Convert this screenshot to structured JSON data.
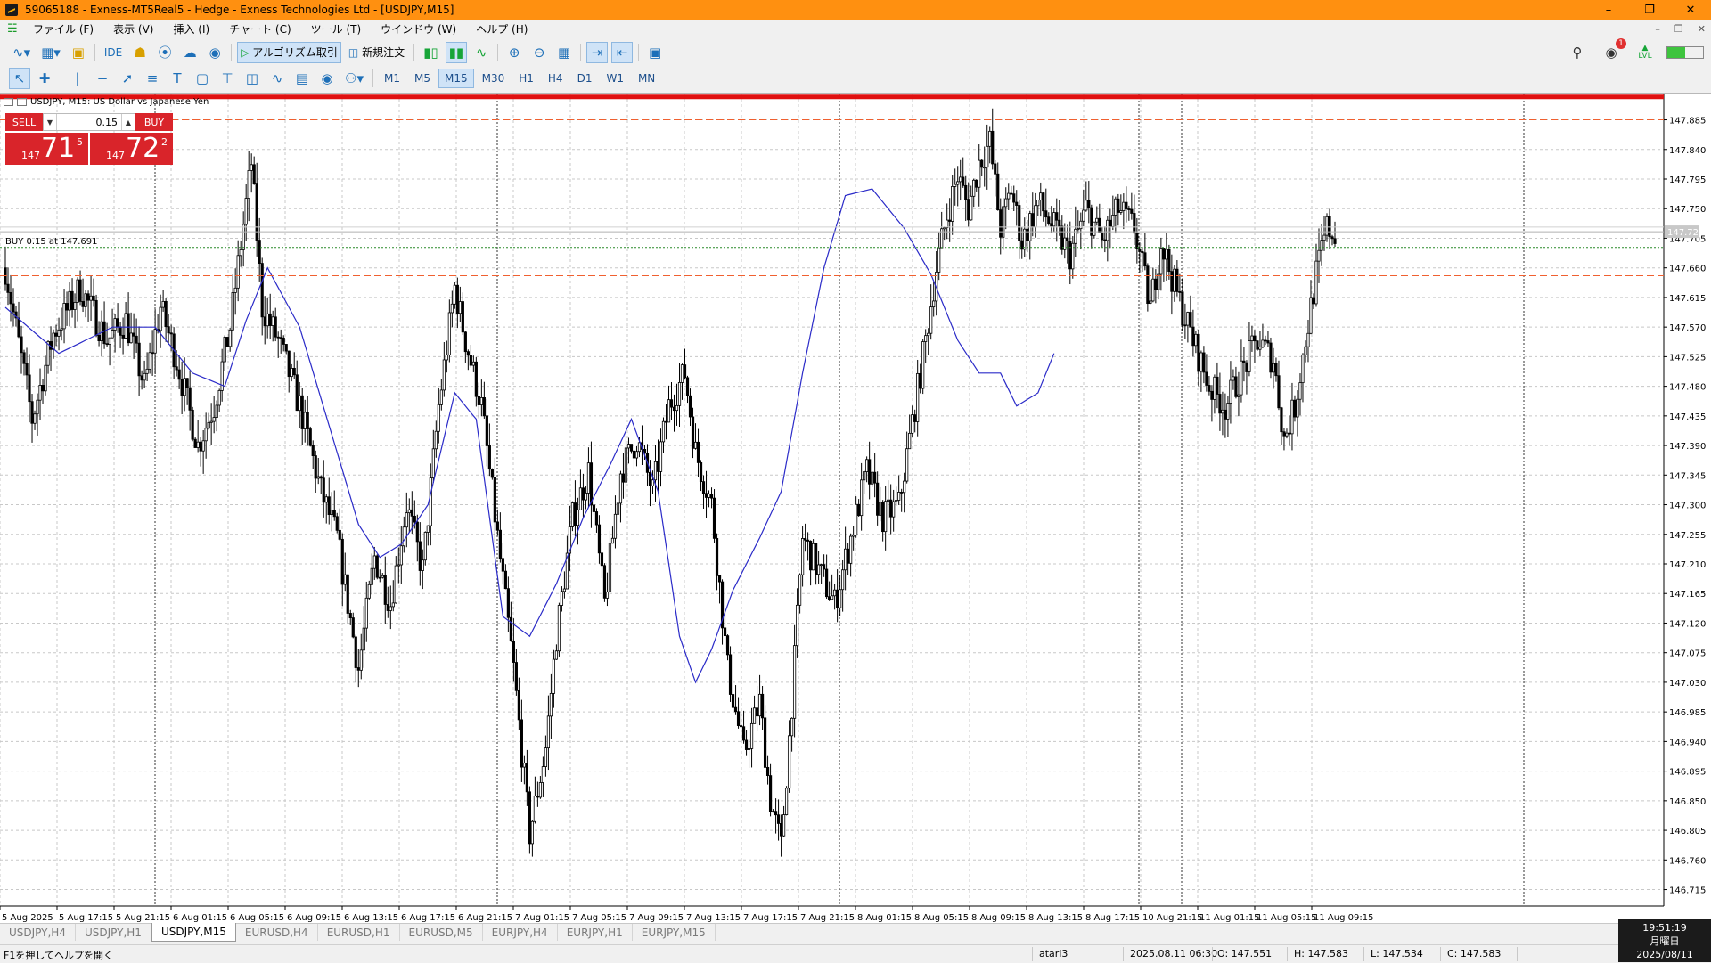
{
  "window": {
    "title": "59065188 - Exness-MT5Real5 - Hedge - Exness Technologies Ltd - [USDJPY,M15]"
  },
  "menu": [
    "ファイル (F)",
    "表示 (V)",
    "挿入 (I)",
    "チャート (C)",
    "ツール (T)",
    "ウインドウ (W)",
    "ヘルプ (H)"
  ],
  "toolbar1": {
    "ide_label": "IDE",
    "algo_label": "アルゴリズム取引",
    "new_order_label": "新規注文",
    "notifications_count": "1",
    "signal_label": "LVL"
  },
  "timeframes": [
    {
      "label": "M1",
      "active": false
    },
    {
      "label": "M5",
      "active": false
    },
    {
      "label": "M15",
      "active": true
    },
    {
      "label": "M30",
      "active": false
    },
    {
      "label": "H1",
      "active": false
    },
    {
      "label": "H4",
      "active": false
    },
    {
      "label": "D1",
      "active": false
    },
    {
      "label": "W1",
      "active": false
    },
    {
      "label": "MN",
      "active": false
    }
  ],
  "chart_header": "USDJPY, M15:  US Dollar vs Japanese Yen",
  "one_click": {
    "sell_label": "SELL",
    "buy_label": "BUY",
    "volume": "0.15",
    "sell_prefix": "147",
    "sell_big": "71",
    "sell_sup": "5",
    "buy_prefix": "147",
    "buy_big": "72",
    "buy_sup": "2"
  },
  "position_label": "BUY 0.15 at 147.691",
  "current_price_label": "147.720",
  "chart_data": {
    "type": "candlestick",
    "symbol": "USDJPY",
    "timeframe": "M15",
    "ylim": [
      146.69,
      147.925
    ],
    "y_ticks": [
      "147.885",
      "147.840",
      "147.795",
      "147.750",
      "147.705",
      "147.660",
      "147.615",
      "147.570",
      "147.525",
      "147.480",
      "147.435",
      "147.390",
      "147.345",
      "147.300",
      "147.255",
      "147.210",
      "147.165",
      "147.120",
      "147.075",
      "147.030",
      "146.985",
      "146.940",
      "146.895",
      "146.850",
      "146.805",
      "146.760",
      "146.715"
    ],
    "x_ticks": [
      "5 Aug 2025",
      "5 Aug 17:15",
      "5 Aug 21:15",
      "6 Aug 01:15",
      "6 Aug 05:15",
      "6 Aug 09:15",
      "6 Aug 13:15",
      "6 Aug 17:15",
      "6 Aug 21:15",
      "7 Aug 01:15",
      "7 Aug 05:15",
      "7 Aug 09:15",
      "7 Aug 13:15",
      "7 Aug 17:15",
      "7 Aug 21:15",
      "8 Aug 01:15",
      "8 Aug 05:15",
      "8 Aug 09:15",
      "8 Aug 13:15",
      "8 Aug 17:15",
      "10 Aug 21:15",
      "11 Aug 01:15",
      "11 Aug 05:15",
      "11 Aug 09:15"
    ],
    "price_path": [
      [
        0,
        147.66
      ],
      [
        10,
        147.43
      ],
      [
        18,
        147.56
      ],
      [
        28,
        147.63
      ],
      [
        38,
        147.55
      ],
      [
        45,
        147.58
      ],
      [
        52,
        147.48
      ],
      [
        58,
        147.6
      ],
      [
        64,
        147.52
      ],
      [
        72,
        147.39
      ],
      [
        78,
        147.45
      ],
      [
        84,
        147.57
      ],
      [
        92,
        147.82
      ],
      [
        96,
        147.6
      ],
      [
        102,
        147.55
      ],
      [
        110,
        147.45
      ],
      [
        118,
        147.32
      ],
      [
        124,
        147.25
      ],
      [
        132,
        147.05
      ],
      [
        138,
        147.22
      ],
      [
        144,
        147.15
      ],
      [
        150,
        147.3
      ],
      [
        156,
        147.2
      ],
      [
        162,
        147.45
      ],
      [
        168,
        147.63
      ],
      [
        172,
        147.55
      ],
      [
        178,
        147.45
      ],
      [
        184,
        147.25
      ],
      [
        190,
        147.05
      ],
      [
        196,
        146.8
      ],
      [
        202,
        146.93
      ],
      [
        206,
        147.1
      ],
      [
        212,
        147.28
      ],
      [
        218,
        147.35
      ],
      [
        224,
        147.15
      ],
      [
        230,
        147.35
      ],
      [
        236,
        147.4
      ],
      [
        242,
        147.32
      ],
      [
        248,
        147.45
      ],
      [
        254,
        147.5
      ],
      [
        258,
        147.38
      ],
      [
        264,
        147.3
      ],
      [
        270,
        147.05
      ],
      [
        276,
        146.92
      ],
      [
        282,
        147.0
      ],
      [
        286,
        146.85
      ],
      [
        290,
        146.78
      ],
      [
        294,
        147.0
      ],
      [
        298,
        147.25
      ],
      [
        304,
        147.2
      ],
      [
        310,
        147.15
      ],
      [
        316,
        147.25
      ],
      [
        322,
        147.35
      ],
      [
        328,
        147.28
      ],
      [
        334,
        147.3
      ],
      [
        340,
        147.45
      ],
      [
        344,
        147.55
      ],
      [
        348,
        147.66
      ],
      [
        352,
        147.74
      ],
      [
        356,
        147.8
      ],
      [
        360,
        147.75
      ],
      [
        364,
        147.82
      ],
      [
        368,
        147.85
      ],
      [
        372,
        147.72
      ],
      [
        376,
        147.78
      ],
      [
        380,
        147.7
      ],
      [
        386,
        147.76
      ],
      [
        392,
        147.72
      ],
      [
        398,
        147.68
      ],
      [
        404,
        147.75
      ],
      [
        410,
        147.7
      ],
      [
        416,
        147.75
      ],
      [
        422,
        147.72
      ],
      [
        428,
        147.6
      ],
      [
        432,
        147.7
      ],
      [
        438,
        147.62
      ],
      [
        444,
        147.55
      ],
      [
        450,
        147.48
      ],
      [
        456,
        147.45
      ],
      [
        462,
        147.5
      ],
      [
        468,
        147.55
      ],
      [
        474,
        147.52
      ],
      [
        478,
        147.4
      ],
      [
        482,
        147.45
      ],
      [
        486,
        147.55
      ],
      [
        490,
        147.65
      ],
      [
        494,
        147.72
      ],
      [
        498,
        147.71
      ]
    ],
    "n_bars": 498,
    "moving_average": [
      [
        0,
        147.6
      ],
      [
        20,
        147.53
      ],
      [
        40,
        147.57
      ],
      [
        56,
        147.57
      ],
      [
        70,
        147.5
      ],
      [
        82,
        147.48
      ],
      [
        90,
        147.58
      ],
      [
        98,
        147.66
      ],
      [
        110,
        147.57
      ],
      [
        124,
        147.38
      ],
      [
        132,
        147.27
      ],
      [
        140,
        147.22
      ],
      [
        148,
        147.24
      ],
      [
        158,
        147.3
      ],
      [
        168,
        147.47
      ],
      [
        176,
        147.43
      ],
      [
        186,
        147.13
      ],
      [
        196,
        147.1
      ],
      [
        206,
        147.18
      ],
      [
        216,
        147.28
      ],
      [
        226,
        147.36
      ],
      [
        234,
        147.43
      ],
      [
        244,
        147.32
      ],
      [
        252,
        147.1
      ],
      [
        258,
        147.03
      ],
      [
        264,
        147.08
      ],
      [
        272,
        147.17
      ],
      [
        282,
        147.25
      ],
      [
        290,
        147.32
      ],
      [
        298,
        147.5
      ],
      [
        306,
        147.66
      ],
      [
        314,
        147.77
      ],
      [
        324,
        147.78
      ],
      [
        336,
        147.72
      ],
      [
        346,
        147.65
      ],
      [
        356,
        147.55
      ],
      [
        364,
        147.5
      ],
      [
        372,
        147.5
      ],
      [
        378,
        147.45
      ],
      [
        386,
        147.47
      ],
      [
        392,
        147.53
      ]
    ],
    "horizontal_lines": {
      "red_top": 147.92,
      "red_dashed_upper": 147.885,
      "red_dashed_lower": 147.648,
      "green_dotted_position": 147.691
    },
    "candle_color": "#000000",
    "ma_color": "#2b2bc8"
  },
  "tabs": [
    {
      "label": "USDJPY,H4",
      "active": false
    },
    {
      "label": "USDJPY,H1",
      "active": false
    },
    {
      "label": "USDJPY,M15",
      "active": true
    },
    {
      "label": "EURUSD,H4",
      "active": false
    },
    {
      "label": "EURUSD,H1",
      "active": false
    },
    {
      "label": "EURUSD,M5",
      "active": false
    },
    {
      "label": "EURJPY,H4",
      "active": false
    },
    {
      "label": "EURJPY,H1",
      "active": false
    },
    {
      "label": "EURJPY,M15",
      "active": false
    }
  ],
  "status": {
    "help": "F1を押してヘルプを開く",
    "profile": "atari3",
    "datetime": "2025.08.11 06:30",
    "open": "O: 147.551",
    "high": "H: 147.583",
    "low": "L: 147.534",
    "close": "C: 147.583"
  },
  "clock": {
    "time": "19:51:19",
    "day": "月曜日",
    "date": "2025/08/11"
  },
  "colors": {
    "title_bar": "#ff9010",
    "sell_buy": "#d9242a",
    "accent": "#1d6fb8"
  }
}
